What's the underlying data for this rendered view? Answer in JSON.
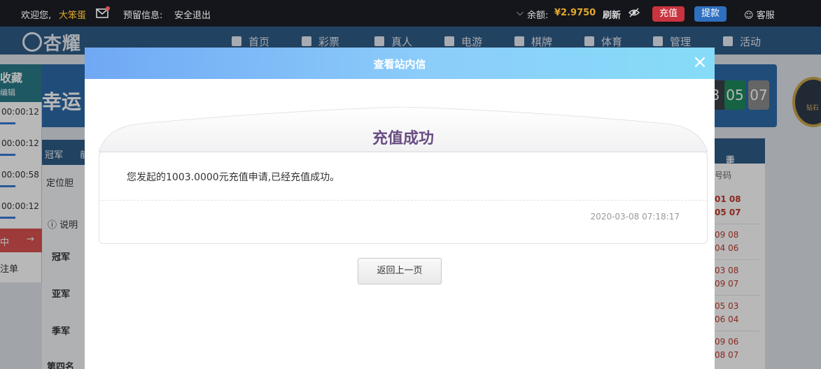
{
  "topbar": {
    "welcome": "欢迎您,",
    "username": "大笨蛋",
    "reserved_info": "预留信息:",
    "logout": "安全退出",
    "balance_label": "余额:",
    "balance_value": "¥2.9750",
    "refresh": "刷新",
    "recharge": "充值",
    "withdraw": "提款",
    "service": "客服"
  },
  "nav": {
    "logo": "杏耀",
    "items": [
      "首页",
      "彩票",
      "真人",
      "电游",
      "棋牌",
      "体育",
      "管理",
      "活动"
    ]
  },
  "background": {
    "hero_text": "幸运",
    "timer_digits": [
      "3",
      "05",
      "07"
    ],
    "badge_text": "钻石",
    "left_panel": {
      "head_title": "收藏",
      "head_sub": "编辑",
      "timers": [
        "00:00:12",
        "00:00:12",
        "00:00:58",
        "00:00:12"
      ],
      "red_text": "中",
      "red_arrow": "→",
      "last_text": "注单"
    },
    "mid_left": {
      "tab": "冠军",
      "tab2": "前",
      "row1": "定位胆",
      "info": "说明",
      "ranks": [
        "冠军",
        "亚军",
        "季军",
        "第四名"
      ]
    },
    "right_panel": {
      "head": "走势图",
      "sub": "号码",
      "numbers": [
        "01 08",
        "05 07",
        "09 08",
        "04 06",
        "03 08",
        "09 07",
        "05 03",
        "06 04",
        "09 06",
        "08 07"
      ]
    }
  },
  "modal": {
    "title": "查看站内信",
    "close": "×",
    "message_title": "充值成功",
    "message_body": "您发起的1003.0000元充值申请,已经充值成功。",
    "message_time": "2020-03-08 07:18:17",
    "back_button": "返回上一页"
  },
  "colors": {
    "modal_header_start": "#70a8f4",
    "modal_header_end": "#86dcf8",
    "title_purple": "#6a4c82",
    "balance_gold": "#e4a92a"
  }
}
